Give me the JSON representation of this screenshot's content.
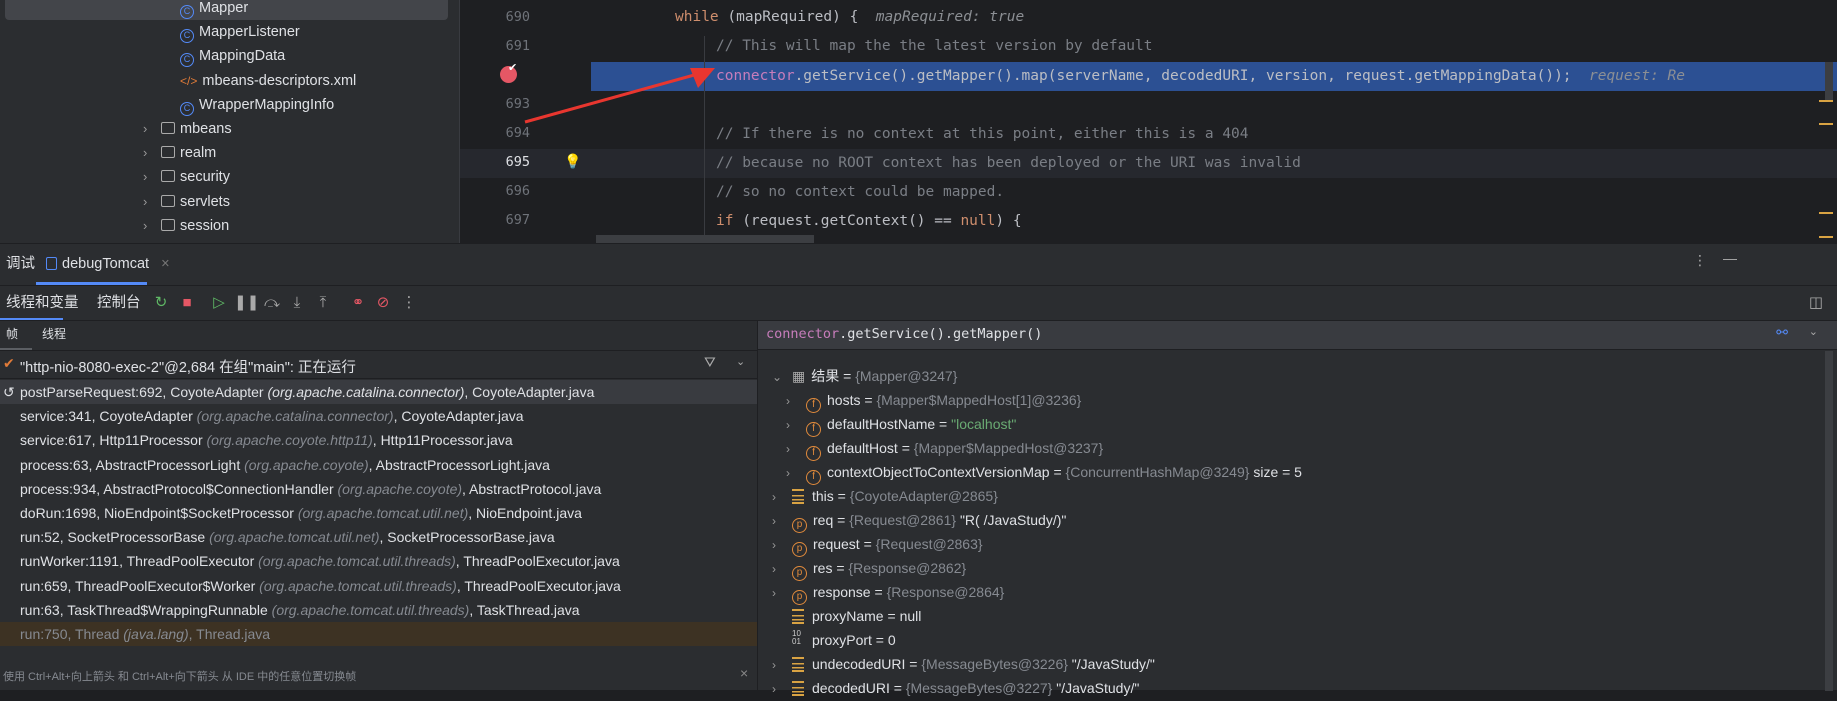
{
  "project_tree": {
    "items": [
      {
        "label": "Mapper",
        "icon": "class-icon",
        "selected": true
      },
      {
        "label": "MapperListener",
        "icon": "class-icon"
      },
      {
        "label": "MappingData",
        "icon": "class-icon"
      },
      {
        "label": "mbeans-descriptors.xml",
        "icon": "xml-icon"
      },
      {
        "label": "WrapperMappingInfo",
        "icon": "class-icon"
      },
      {
        "label": "mbeans",
        "icon": "package-icon"
      },
      {
        "label": "realm",
        "icon": "package-icon"
      },
      {
        "label": "security",
        "icon": "package-icon"
      },
      {
        "label": "servlets",
        "icon": "package-icon"
      },
      {
        "label": "session",
        "icon": "package-icon"
      }
    ]
  },
  "editor": {
    "line_numbers": [
      "690",
      "691",
      "",
      "693",
      "694",
      "695",
      "696",
      "697"
    ],
    "lines": {
      "l690_kw": "while",
      "l690_rest": " (mapRequired) {  ",
      "l690_hint": "mapRequired: true",
      "l691": "// This will map the the latest version by default",
      "l692_obj": "connector",
      "l692_rest": ".getService().getMapper().map(serverName, decodedURI, version, request.getMappingData());  ",
      "l692_hint": "request: Re",
      "l694": "// If there is no context at this point, either this is a 404",
      "l695": "// because no ROOT context has been deployed or the URI was invalid",
      "l696": "// so no context could be mapped.",
      "l697_kw": "if",
      "l697_a": " (request.getContext() == ",
      "l697_null": "null",
      "l697_b": ") {"
    }
  },
  "debug": {
    "title": "调试",
    "run_tab": "debugTomcat",
    "toolbar": {
      "threads_vars": "线程和变量",
      "console": "控制台"
    },
    "subtabs": {
      "frames": "帧",
      "threads": "线程"
    },
    "thread_status": "\"http-nio-8080-exec-2\"@2,684 在组\"main\": 正在运行",
    "frames": [
      {
        "m": "postParseRequest:692, CoyoteAdapter ",
        "p": "(org.apache.catalina.connector)",
        "f": ", CoyoteAdapter.java"
      },
      {
        "m": "service:341, CoyoteAdapter ",
        "p": "(org.apache.catalina.connector)",
        "f": ", CoyoteAdapter.java"
      },
      {
        "m": "service:617, Http11Processor ",
        "p": "(org.apache.coyote.http11)",
        "f": ", Http11Processor.java"
      },
      {
        "m": "process:63, AbstractProcessorLight ",
        "p": "(org.apache.coyote)",
        "f": ", AbstractProcessorLight.java"
      },
      {
        "m": "process:934, AbstractProtocol$ConnectionHandler ",
        "p": "(org.apache.coyote)",
        "f": ", AbstractProtocol.java"
      },
      {
        "m": "doRun:1698, NioEndpoint$SocketProcessor ",
        "p": "(org.apache.tomcat.util.net)",
        "f": ", NioEndpoint.java"
      },
      {
        "m": "run:52, SocketProcessorBase ",
        "p": "(org.apache.tomcat.util.net)",
        "f": ", SocketProcessorBase.java"
      },
      {
        "m": "runWorker:1191, ThreadPoolExecutor ",
        "p": "(org.apache.tomcat.util.threads)",
        "f": ", ThreadPoolExecutor.java"
      },
      {
        "m": "run:659, ThreadPoolExecutor$Worker ",
        "p": "(org.apache.tomcat.util.threads)",
        "f": ", ThreadPoolExecutor.java"
      },
      {
        "m": "run:63, TaskThread$WrappingRunnable ",
        "p": "(org.apache.tomcat.util.threads)",
        "f": ", TaskThread.java"
      },
      {
        "m": "run:750, Thread ",
        "p": "(java.lang)",
        "f": ", Thread.java"
      }
    ],
    "hint": "使用 Ctrl+Alt+向上箭头 和 Ctrl+Alt+向下箭头 从 IDE 中的任意位置切换帧",
    "expression_obj": "connector",
    "expression_rest": ".getService().getMapper()",
    "variables": [
      {
        "name": "结果",
        "eq": " = ",
        "type": "{Mapper@3247}",
        "val": "",
        "icon": "table-icon",
        "level": 0,
        "chev": "v"
      },
      {
        "name": "hosts",
        "eq": " = ",
        "type": "{Mapper$MappedHost[1]@3236}",
        "val": "",
        "icon": "field-icon",
        "level": 1,
        "chev": ">"
      },
      {
        "name": "defaultHostName",
        "eq": " = ",
        "type": "",
        "val": "\"localhost\"",
        "icon": "field-icon",
        "level": 1,
        "chev": ">",
        "str": true
      },
      {
        "name": "defaultHost",
        "eq": " = ",
        "type": "{Mapper$MappedHost@3237}",
        "val": "",
        "icon": "field-icon",
        "level": 1,
        "chev": ">"
      },
      {
        "name": "contextObjectToContextVersionMap",
        "eq": " = ",
        "type": "{ConcurrentHashMap@3249}",
        "val": "  size = 5",
        "icon": "field-icon",
        "level": 1,
        "chev": ">"
      },
      {
        "name": "this",
        "eq": " = ",
        "type": "{CoyoteAdapter@2865}",
        "val": "",
        "icon": "variable-icon",
        "level": 0,
        "chev": ">"
      },
      {
        "name": "req",
        "eq": " = ",
        "type": "{Request@2861}",
        "val": " \"R( /JavaStudy/)\"",
        "icon": "parameter-icon",
        "level": 0,
        "chev": ">"
      },
      {
        "name": "request",
        "eq": " = ",
        "type": "{Request@2863}",
        "val": "",
        "icon": "parameter-icon",
        "level": 0,
        "chev": ">"
      },
      {
        "name": "res",
        "eq": " = ",
        "type": "{Response@2862}",
        "val": "",
        "icon": "parameter-icon",
        "level": 0,
        "chev": ">"
      },
      {
        "name": "response",
        "eq": " = ",
        "type": "{Response@2864}",
        "val": "",
        "icon": "parameter-icon",
        "level": 0,
        "chev": ">"
      },
      {
        "name": "proxyName",
        "eq": " = ",
        "type": "",
        "val": "null",
        "icon": "variable-icon",
        "level": 0,
        "chev": ""
      },
      {
        "name": "proxyPort",
        "eq": " = ",
        "type": "",
        "val": "0",
        "icon": "primitive-icon",
        "level": 0,
        "chev": ""
      },
      {
        "name": "undecodedURI",
        "eq": " = ",
        "type": "{MessageBytes@3226}",
        "val": " \"/JavaStudy/\"",
        "icon": "variable-icon",
        "level": 0,
        "chev": ">"
      },
      {
        "name": "decodedURI",
        "eq": " = ",
        "type": "{MessageBytes@3227}",
        "val": " \"/JavaStudy/\"",
        "icon": "variable-icon",
        "level": 0,
        "chev": ">"
      }
    ]
  },
  "colors": {
    "accent": "#548af7",
    "highlight": "#2c5093",
    "breakpoint": "#e55765",
    "arrow": "#e8362f"
  }
}
